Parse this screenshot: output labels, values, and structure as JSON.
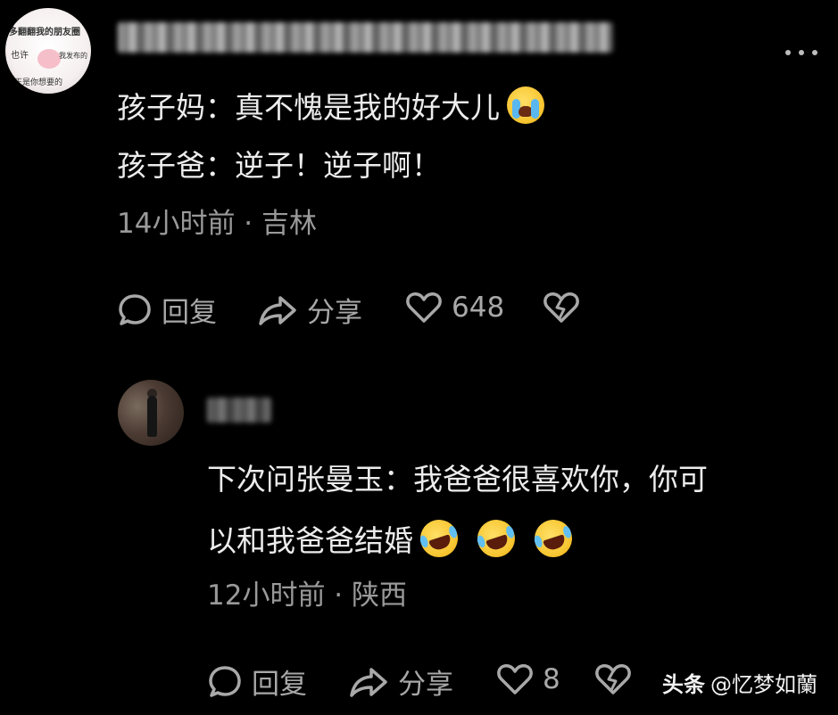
{
  "comment1": {
    "lines": [
      "孩子妈：真不愧是我的好大儿",
      "孩子爸：逆子！逆子啊！"
    ],
    "meta": "14小时前 · 吉林",
    "actions": {
      "reply": "回复",
      "share": "分享",
      "like_count": "648"
    },
    "avatar_text": [
      "多翻翻我的朋友圈",
      "也许",
      "我发布的",
      "正是你想要的"
    ],
    "emoji": [
      "loudly-crying-face"
    ]
  },
  "comment2": {
    "username_partial": "",
    "lines": [
      "下次问张曼玉：我爸爸很喜欢你，你可",
      "以和我爸爸结婚"
    ],
    "meta": "12小时前 · 陕西",
    "actions": {
      "reply": "回复",
      "share": "分享",
      "like_count": "8"
    },
    "emoji": [
      "rolling-on-floor-laughing",
      "rolling-on-floor-laughing",
      "rolling-on-floor-laughing"
    ]
  },
  "watermark": {
    "brand": "头条",
    "handle": "@忆梦如蘭"
  },
  "colors": {
    "background": "#000000",
    "text": "#ececec",
    "meta": "#9a9a9a",
    "icon": "#a8a8a8"
  }
}
